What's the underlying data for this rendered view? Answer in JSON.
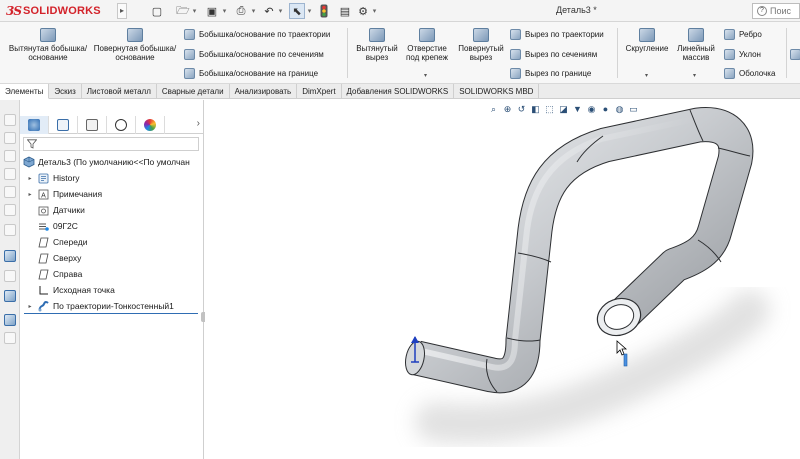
{
  "app": {
    "brand_ds": "3S",
    "brand_word": "SOLIDWORKS",
    "document_title": "Деталь3 *"
  },
  "search": {
    "placeholder": "Поис"
  },
  "ribbon": {
    "extruded_boss": "Вытянутая бобышка/основание",
    "revolved_boss": "Повернутая бобышка/основание",
    "swept_boss": "Бобышка/основание по траектории",
    "lofted_boss": "Бобышка/основание по сечениям",
    "boundary_boss": "Бобышка/основание на границе",
    "extruded_cut": "Вытянутый вырез",
    "hole_wizard": "Отверстие под крепеж",
    "revolved_cut": "Повернутый вырез",
    "swept_cut": "Вырез по траектории",
    "lofted_cut": "Вырез по сечениям",
    "boundary_cut": "Вырез по границе",
    "fillet": "Скругление",
    "linear_pattern": "Линейный массив",
    "rib": "Ребро",
    "draft": "Уклон",
    "shell": "Оболочка"
  },
  "tabs": [
    {
      "label": "Элементы",
      "active": true
    },
    {
      "label": "Эскиз"
    },
    {
      "label": "Листовой металл"
    },
    {
      "label": "Сварные детали"
    },
    {
      "label": "Анализировать"
    },
    {
      "label": "DimXpert"
    },
    {
      "label": "Добавления SOLIDWORKS"
    },
    {
      "label": "SOLIDWORKS MBD"
    }
  ],
  "tree": {
    "part": "Деталь3  (По умолчанию<<По умолчан",
    "items": [
      {
        "label": "History",
        "icon": "history-icon",
        "expandable": true
      },
      {
        "label": "Примечания",
        "icon": "annotations-icon",
        "expandable": true
      },
      {
        "label": "Датчики",
        "icon": "sensors-icon",
        "expandable": false
      },
      {
        "label": "09Г2С",
        "icon": "material-icon",
        "expandable": false
      },
      {
        "label": "Спереди",
        "icon": "plane-icon",
        "expandable": false
      },
      {
        "label": "Сверху",
        "icon": "plane-icon",
        "expandable": false
      },
      {
        "label": "Справа",
        "icon": "plane-icon",
        "expandable": false
      },
      {
        "label": "Исходная точка",
        "icon": "origin-icon",
        "expandable": false
      },
      {
        "label": "По траектории-Тонкостенный1",
        "icon": "sweep-feature-icon",
        "expandable": true
      }
    ]
  },
  "colors": {
    "brand": "#d3222a",
    "accent": "#2f6db3",
    "model": "#c6c9cd"
  }
}
